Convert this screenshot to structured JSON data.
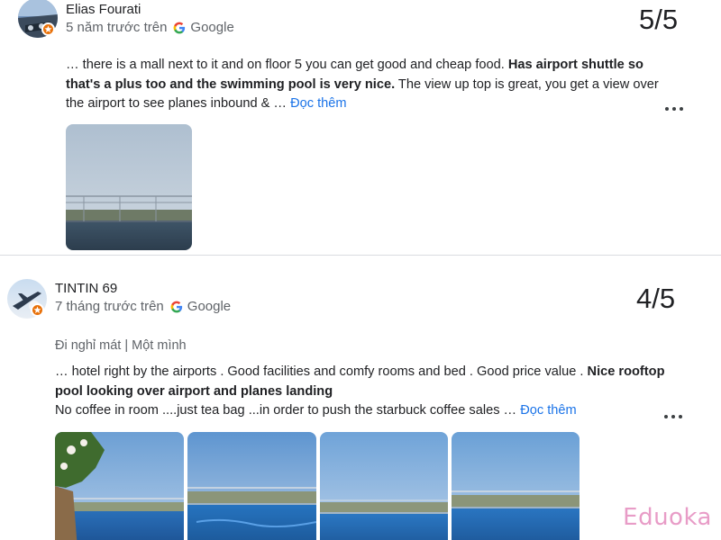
{
  "reviews": [
    {
      "author": "Elias Fourati",
      "time": "5 năm trước trên",
      "source": "Google",
      "score": "5/5",
      "text_before": "… there is a mall next to it and on floor 5 you can get good and cheap food. ",
      "text_bold": "Has airport shuttle so that's a plus too and the swimming pool is very nice.",
      "text_after": " The view up top is great, you get a view over the airport to see planes inbound & … ",
      "more_label": "Đọc thêm",
      "avatar_icon": "airplane-cockpit-avatar",
      "photo_count": 1
    },
    {
      "author": "TINTIN 69",
      "time": "7 tháng trước trên",
      "source": "Google",
      "score": "4/5",
      "trip_tags": "Đi nghỉ mát | Một mình",
      "text_before": "… hotel right by the airports . Good facilities and comfy rooms and bed . Good price value . ",
      "text_bold": "Nice rooftop pool looking over airport and planes landing",
      "text_after": "No coffee in room ....just tea bag ...in order to push the starbuck coffee sales … ",
      "more_label": "Đọc thêm",
      "avatar_icon": "sky-plane-avatar",
      "photo_count": 4
    }
  ],
  "watermark": "Eduoka",
  "colors": {
    "link": "#1a73e8",
    "badge": "#e8710a",
    "watermark": "#e89cc7"
  }
}
